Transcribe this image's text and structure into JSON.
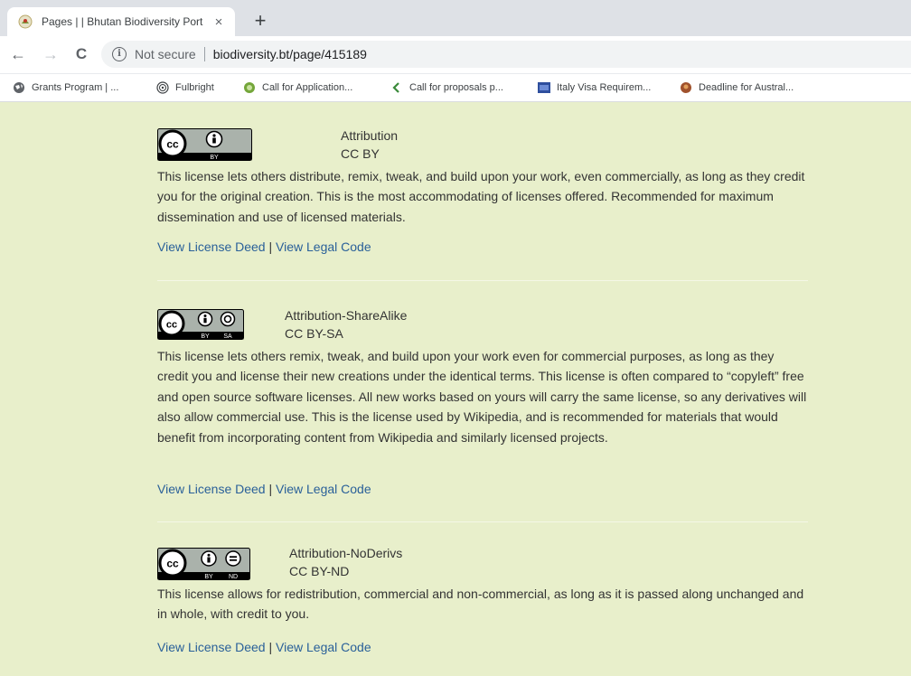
{
  "browser": {
    "tab_title": "Pages | | Bhutan Biodiversity Port",
    "tab_close": "×",
    "new_tab": "+",
    "back": "←",
    "forward": "→",
    "reload": "C",
    "security_text": "Not secure",
    "url": "biodiversity.bt/page/415189",
    "bookmarks": [
      {
        "label": "Grants Program | ...",
        "icon": "globe-icon"
      },
      {
        "label": "Fulbright",
        "icon": "fulbright-icon"
      },
      {
        "label": "Call for Application...",
        "icon": "green-circle-icon"
      },
      {
        "label": "Call for proposals p...",
        "icon": "green-check-icon"
      },
      {
        "label": "Italy Visa Requirem...",
        "icon": "flag-icon"
      },
      {
        "label": "Deadline for Austral...",
        "icon": "brown-circle-icon"
      }
    ]
  },
  "licenses": [
    {
      "name": "Attribution",
      "code": "CC BY",
      "badge_text": "BY",
      "description": "This license lets others distribute, remix, tweak, and build upon your work, even commercially, as long as they credit you for the original creation. This is the most accommodating of licenses offered. Recommended for maximum dissemination and use of licensed materials.",
      "deed_link": "View License Deed",
      "separator": "|",
      "legal_link": "View Legal Code"
    },
    {
      "name": "Attribution-ShareAlike",
      "code": "CC BY-SA",
      "badge_text_1": "BY",
      "badge_text_2": "SA",
      "description": "This license lets others remix, tweak, and build upon your work even for commercial purposes, as long as they credit you and license their new creations under the identical terms. This license is often compared to “copyleft” free and open source software licenses. All new works based on yours will carry the same license, so any derivatives will also allow commercial use. This is the license used by Wikipedia, and is recommended for materials that would benefit from incorporating content from Wikipedia and similarly licensed projects.",
      "deed_link": "View License Deed",
      "separator": "|",
      "legal_link": "View Legal Code"
    },
    {
      "name": "Attribution-NoDerivs",
      "code": "CC BY-ND",
      "badge_text_1": "BY",
      "badge_text_2": "ND",
      "description": "This license allows for redistribution, commercial and non-commercial, as long as it is passed along unchanged and in whole, with credit to you.",
      "deed_link": "View License Deed",
      "separator": "|",
      "legal_link": "View Legal Code"
    }
  ],
  "colors": {
    "page_background": "#e8efcb",
    "link": "#2a6099",
    "text": "#333333"
  }
}
